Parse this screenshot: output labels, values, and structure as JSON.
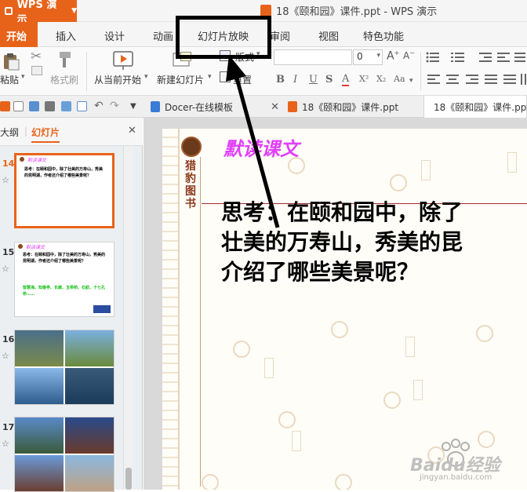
{
  "app": {
    "menu_label": "WPS 演示",
    "window_title": "18《颐和园》课件.ppt - WPS 演示"
  },
  "ribbon_tabs": [
    "开始",
    "插入",
    "设计",
    "动画",
    "幻灯片放映",
    "审阅",
    "视图",
    "特色功能"
  ],
  "ribbon": {
    "paste": "粘贴",
    "format_painter": "格式刷",
    "play_from_current": "从当前开始",
    "new_slide": "新建幻灯片",
    "layout": "版式",
    "reset": "重置",
    "font_size": "0"
  },
  "doc_tabs": {
    "docer": "Docer-在线模板",
    "file1": "18《颐和园》课件.ppt",
    "file2": "18《颐和园》课件.ppt"
  },
  "left_pane": {
    "outline_tab": "大纲",
    "slides_tab": "幻灯片",
    "slides": [
      {
        "num": "14",
        "title": "默读课文",
        "text": "思考：在颐和园中，除了壮美的万寿山，秀美的昆明湖，作者还介绍了哪些美景呢？"
      },
      {
        "num": "15",
        "title": "默读课文",
        "text": "思考：在颐和园中，除了壮美的万寿山，秀美的昆明湖，作者还介绍了哪些美景呢？",
        "green": "智慧海、知春亭、长廊、玉带桥、石舫、十七孔桥……"
      },
      {
        "num": "16"
      },
      {
        "num": "17"
      }
    ]
  },
  "slide": {
    "heading": "默读课文",
    "logo_text": "猎豹图书",
    "line1": "思考：在颐和园中，除了",
    "line2": "壮美的万寿山，秀美的昆",
    "line3": "介绍了哪些美景呢？"
  },
  "watermark": {
    "brand": "Baidu经验",
    "url": "jingyan.baidu.com"
  },
  "colors": {
    "accent": "#e8631a",
    "heading": "#e040fb",
    "selection_box": "#000000"
  }
}
